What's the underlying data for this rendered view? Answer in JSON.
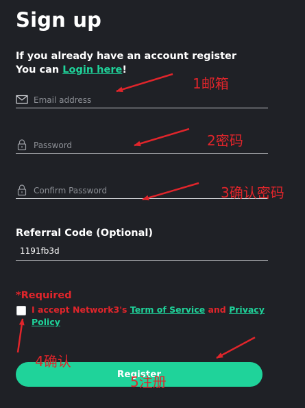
{
  "header": {
    "title": "Sign up"
  },
  "intro": {
    "line1": "If you already have an account register",
    "line2_prefix": "You can ",
    "login_link": "Login here",
    "line2_suffix": "!"
  },
  "fields": {
    "email": {
      "placeholder": "Email address",
      "icon": "mail-icon"
    },
    "password": {
      "placeholder": "Password",
      "icon": "lock-icon"
    },
    "confirm_password": {
      "placeholder": "Confirm Password",
      "icon": "lock-icon"
    }
  },
  "referral": {
    "label": "Referral Code (Optional)",
    "value": "1191fb3d"
  },
  "required_text": "*Required",
  "terms": {
    "prefix": "I accept Network3's ",
    "tos_link": "Term of Service",
    "middle": " and ",
    "privacy_link": "Privacy Policy",
    "checked": false
  },
  "register_button": {
    "label": "Register"
  },
  "annotations": {
    "step1": "1邮箱",
    "step2": "2密码",
    "step3": "3确认密码",
    "step4": "4确认",
    "step5": "5注册"
  },
  "colors": {
    "background": "#1f2126",
    "accent": "#1fd39a",
    "annotation": "#e0252b",
    "underline": "#c9cbcf"
  }
}
